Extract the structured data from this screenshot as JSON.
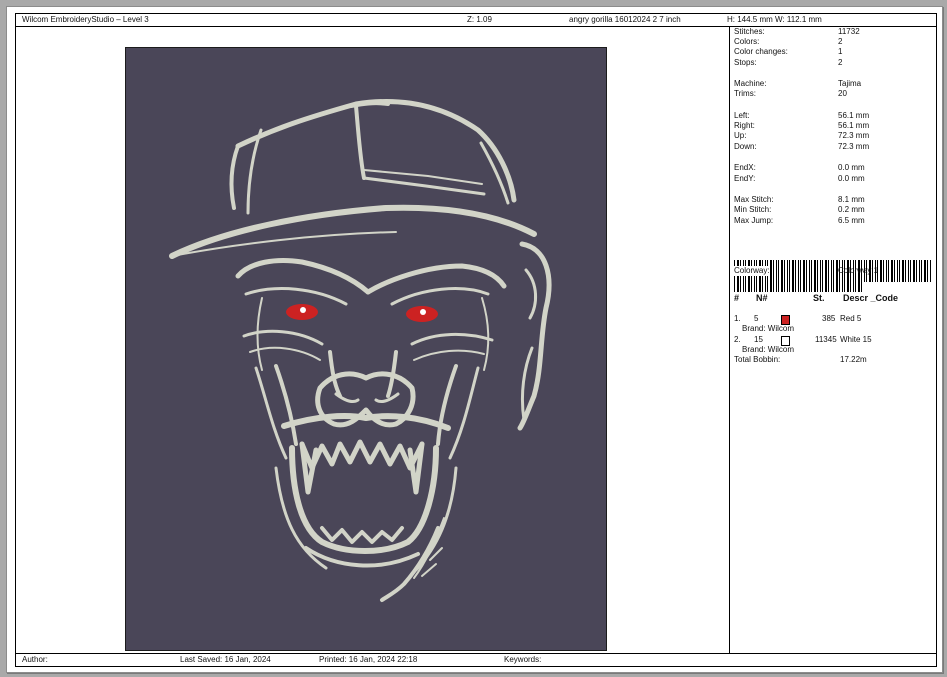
{
  "header": {
    "app_title": "Wilcom EmbroideryStudio – Level 3",
    "zoom": "Z: 1.09",
    "design_name": "angry gorilla 16012024 2 7 inch",
    "dimensions": "H: 144.5 mm   W: 112.1 mm"
  },
  "stats": [
    {
      "label": "Stitches:",
      "value": "11732"
    },
    {
      "label": "Colors:",
      "value": "2"
    },
    {
      "label": "Color changes:",
      "value": "1"
    },
    {
      "label": "Stops:",
      "value": "2"
    },
    {
      "label": "Machine:",
      "value": "Tajima"
    },
    {
      "label": "Trims:",
      "value": "20"
    },
    {
      "label": "Left:",
      "value": "56.1 mm"
    },
    {
      "label": "Right:",
      "value": "56.1 mm"
    },
    {
      "label": "Up:",
      "value": "72.3 mm"
    },
    {
      "label": "Down:",
      "value": "72.3 mm"
    },
    {
      "label": "EndX:",
      "value": "0.0 mm"
    },
    {
      "label": "EndY:",
      "value": "0.0 mm"
    },
    {
      "label": "Max Stitch:",
      "value": "8.1 mm"
    },
    {
      "label": "Min Stitch:",
      "value": "0.2 mm"
    },
    {
      "label": "Max Jump:",
      "value": "6.5 mm"
    }
  ],
  "colorway": {
    "label": "Colorway:",
    "value": "Colorway 1"
  },
  "color_table": {
    "headers": [
      "#",
      "N#",
      "St.",
      "Descr _Code"
    ],
    "rows": [
      {
        "num": "1.",
        "n": "5",
        "swatch": "#cc2222",
        "stitches": "385",
        "descr": "Red 5",
        "brand": "Brand: Wilcom"
      },
      {
        "num": "2.",
        "n": "15",
        "swatch": "#ffffff",
        "stitches": "11345",
        "descr": "White 15",
        "brand": "Brand: Wilcom"
      }
    ]
  },
  "total_bobbin": {
    "label": "Total Bobbin:",
    "value": "17.22m"
  },
  "footer": {
    "author": "Author:",
    "last_saved": "Last Saved: 16 Jan, 2024",
    "printed": "Printed: 16 Jan, 2024 22:18",
    "keywords": "Keywords:"
  },
  "colors": {
    "background": "#4a4658",
    "thread_white": "#d2d4c8",
    "thread_red": "#cc2222"
  }
}
